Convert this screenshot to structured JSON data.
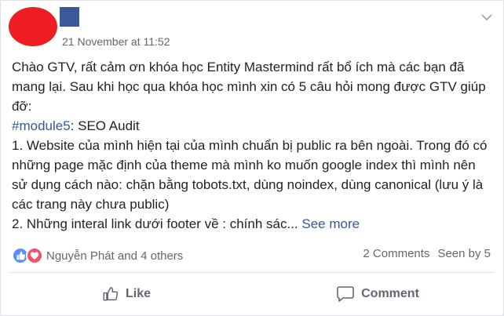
{
  "post": {
    "timestamp": "21 November at 11:52",
    "paragraphs": [
      "Chào GTV, rất cảm ơn khóa học Entity Mastermind rất bổ ích mà các bạn đã mang lại. Sau khi học qua khóa học mình xin có 5 câu hỏi mong được GTV giúp đỡ:"
    ],
    "hashtag": "#module5",
    "hashtag_suffix": ": SEO Audit",
    "line_1": "1. Website của mình hiện tại của mình chuẩn bị public ra bên ngoài. Trong đó có những page mặc định của theme mà mình ko muốn google index thì mình nên sử dụng cách nào: chặn bằng tobots.txt, dùng noindex, dùng canonical (lưu ý là các trang này chưa public)",
    "line_2": "2. Những interal link dưới footer về : chính sác...",
    "see_more": "See more"
  },
  "reactions": {
    "names": "Nguyễn Phát and 4 others",
    "icons": [
      "like-reaction",
      "love-reaction"
    ],
    "like_color": "#5890ff",
    "love_color": "#f25268"
  },
  "stats": {
    "comments": "2 Comments",
    "seen": "Seen by 5"
  },
  "actions": {
    "like": "Like",
    "comment": "Comment"
  },
  "colors": {
    "avatar": "#ee1c23",
    "name_block": "#3b5998",
    "link": "#365899"
  }
}
